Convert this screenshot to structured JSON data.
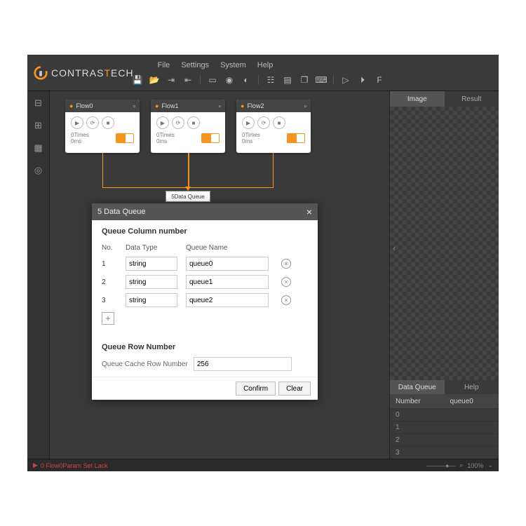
{
  "brand": {
    "name_pre": "CONTRAS",
    "name_post": "ECH"
  },
  "menu": {
    "file": "File",
    "settings": "Settings",
    "system": "System",
    "help": "Help"
  },
  "flows": [
    {
      "name": "Flow0",
      "times": "0Times",
      "ms": "0ms"
    },
    {
      "name": "Flow1",
      "times": "0Times",
      "ms": "0ms"
    },
    {
      "name": "Flow2",
      "times": "0Times",
      "ms": "0ms"
    }
  ],
  "node": {
    "label": "5Data Queue"
  },
  "dialog": {
    "title": "5 Data Queue",
    "section1": "Queue Column number",
    "cols": {
      "no": "No.",
      "type": "Data Type",
      "name": "Queue Name"
    },
    "rows": [
      {
        "no": "1",
        "type": "string",
        "name": "queue0"
      },
      {
        "no": "2",
        "type": "string",
        "name": "queue1"
      },
      {
        "no": "3",
        "type": "string",
        "name": "queue2"
      }
    ],
    "section2": "Queue Row Number",
    "cache_label": "Queue Cache Row Number",
    "cache_value": "256",
    "confirm": "Confirm",
    "clear": "Clear"
  },
  "right": {
    "tab_image": "Image",
    "tab_result": "Result",
    "tab_dq": "Data Queue",
    "tab_help": "Help",
    "col_number": "Number",
    "col_q0": "queue0",
    "rows": [
      "0",
      "1",
      "2",
      "3"
    ]
  },
  "status": {
    "error": "0 Flow0Param Set Lack",
    "zoom": "100%"
  }
}
